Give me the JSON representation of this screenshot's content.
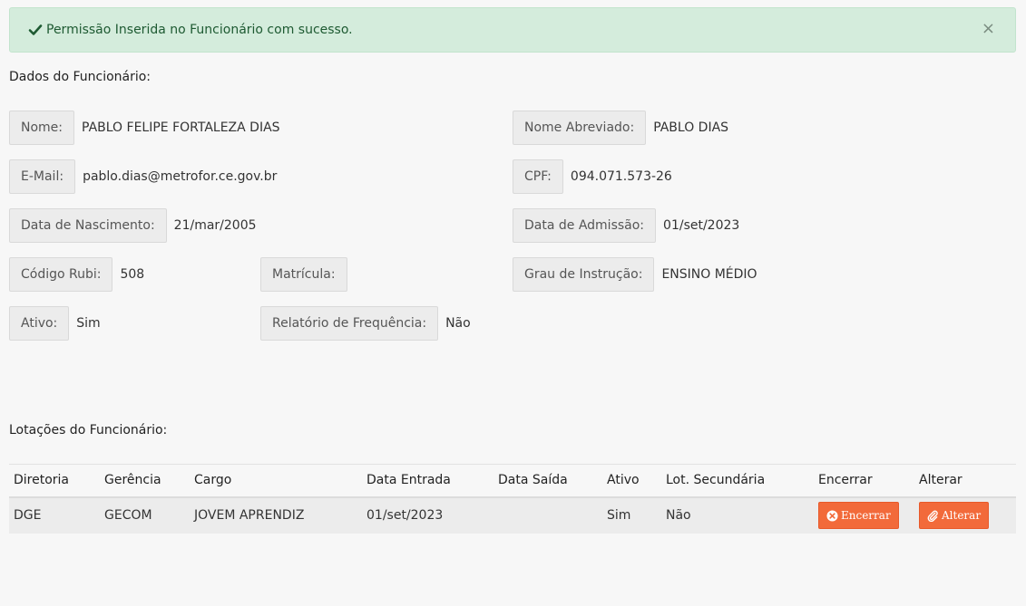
{
  "alert": {
    "message": "Permissão Inserida no Funcionário com sucesso.",
    "close": "×"
  },
  "dados": {
    "title": "Dados do Funcionário:",
    "nome_label": "Nome:",
    "nome": "PABLO FELIPE FORTALEZA DIAS",
    "nome_abrev_label": "Nome Abreviado:",
    "nome_abrev": "PABLO DIAS",
    "email_label": "E-Mail:",
    "email": "pablo.dias@metrofor.ce.gov.br",
    "cpf_label": "CPF:",
    "cpf": "094.071.573-26",
    "nascimento_label": "Data de Nascimento:",
    "nascimento": "21/mar/2005",
    "admissao_label": "Data de Admissão:",
    "admissao": "01/set/2023",
    "codigo_rubi_label": "Código Rubi:",
    "codigo_rubi": "508",
    "matricula_label": "Matrícula:",
    "matricula": "",
    "grau_label": "Grau de Instrução:",
    "grau": "ENSINO MÉDIO",
    "ativo_label": "Ativo:",
    "ativo": "Sim",
    "relatorio_label": "Relatório de Frequência:",
    "relatorio": "Não"
  },
  "lotacoes": {
    "title": "Lotações do Funcionário:",
    "headers": [
      "Diretoria",
      "Gerência",
      "Cargo",
      "Data Entrada",
      "Data Saída",
      "Ativo",
      "Lot. Secundária",
      "Encerrar",
      "Alterar"
    ],
    "rows": [
      {
        "diretoria": "DGE",
        "gerencia": "GECOM",
        "cargo": "JOVEM APRENDIZ",
        "data_entrada": "01/set/2023",
        "data_saida": "",
        "ativo": "Sim",
        "lot_secundaria": "Não",
        "encerrar_label": "Encerrar",
        "alterar_label": "Alterar"
      }
    ]
  },
  "colors": {
    "success_bg": "#d4ecdc",
    "button": "#f26a3a"
  }
}
